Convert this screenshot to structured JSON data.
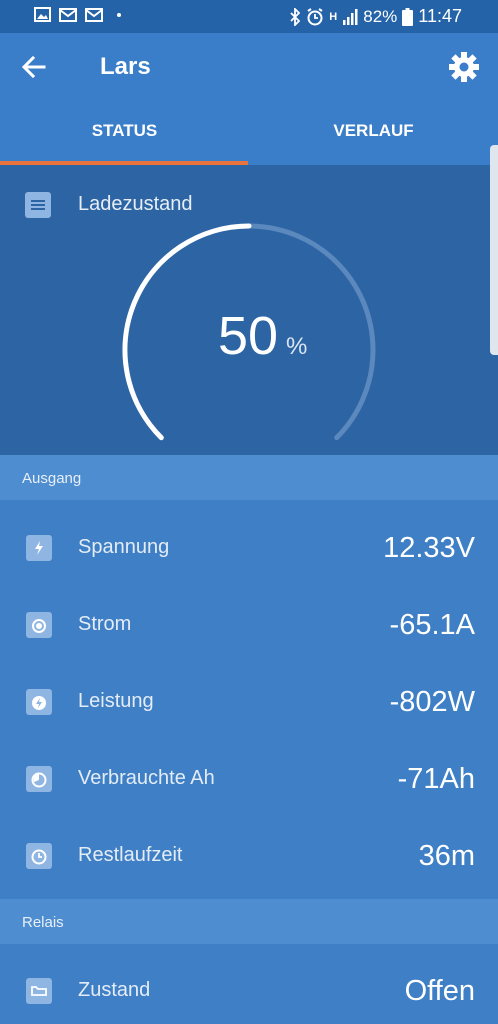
{
  "status_bar": {
    "battery": "82%",
    "time": "11:47",
    "network": "H"
  },
  "app_bar": {
    "title": "Lars"
  },
  "tabs": [
    {
      "label": "STATUS",
      "active": true
    },
    {
      "label": "VERLAUF",
      "active": false
    }
  ],
  "gauge": {
    "label": "Ladezustand",
    "value": "50",
    "unit": "%",
    "fraction": 0.5
  },
  "sections": {
    "ausgang": "Ausgang",
    "relais": "Relais"
  },
  "rows": [
    {
      "label": "Spannung",
      "value": "12.33V",
      "icon": "bolt-icon"
    },
    {
      "label": "Strom",
      "value": "-65.1A",
      "icon": "current-icon"
    },
    {
      "label": "Leistung",
      "value": "-802W",
      "icon": "power-icon"
    },
    {
      "label": "Verbrauchte Ah",
      "value": "-71Ah",
      "icon": "consumed-icon"
    },
    {
      "label": "Restlaufzeit",
      "value": "36m",
      "icon": "clock-icon"
    }
  ],
  "relay": {
    "label": "Zustand",
    "value": "Offen",
    "icon": "relay-icon"
  },
  "colors": {
    "accent": "#e8743b",
    "primary": "#3a7dc8"
  }
}
